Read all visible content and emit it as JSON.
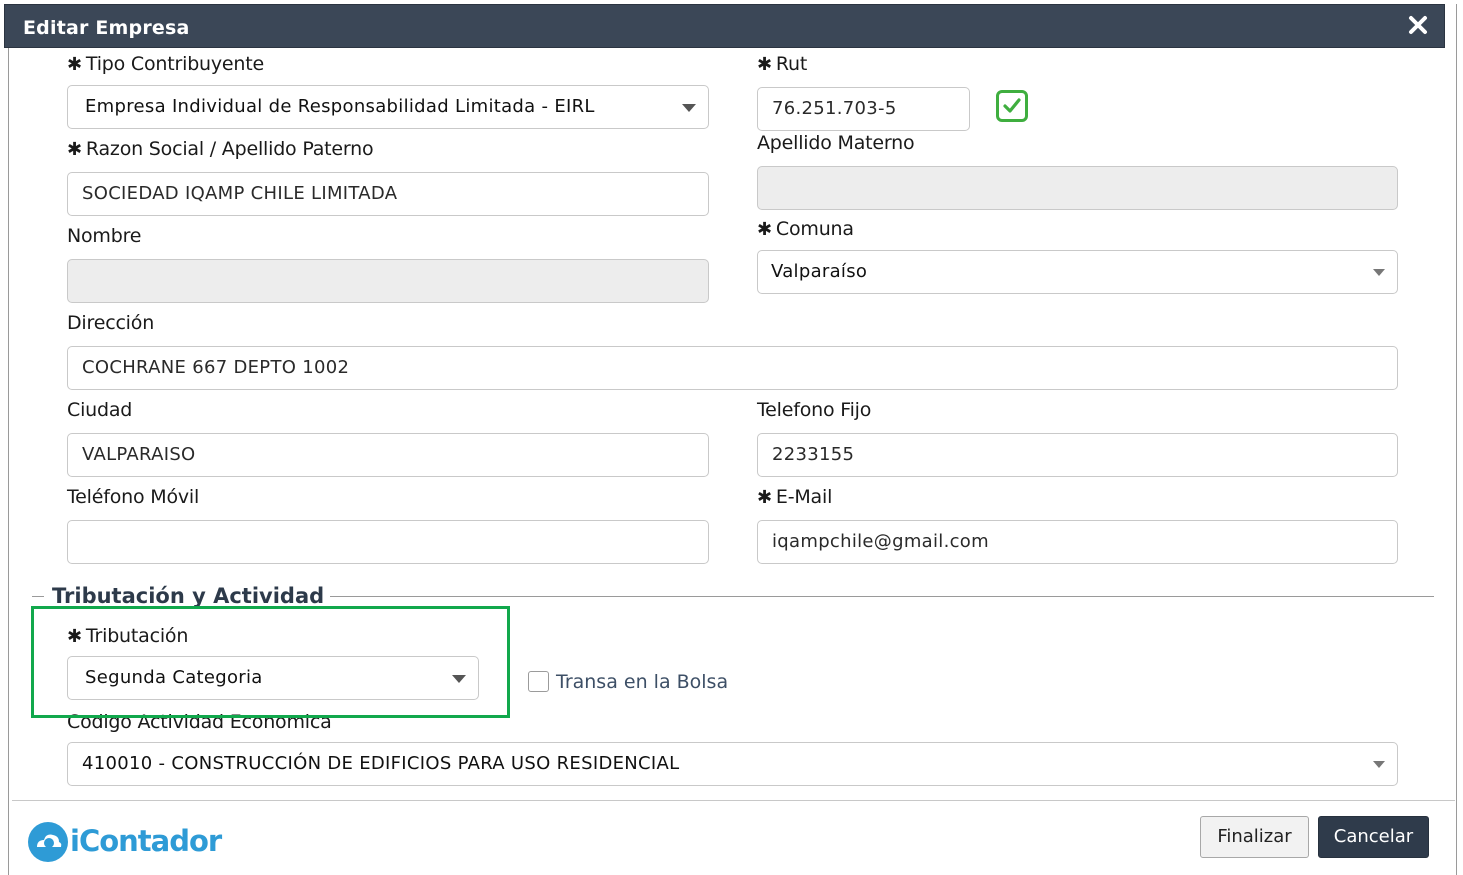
{
  "dialog": {
    "title": "Editar Empresa",
    "close_icon": "close-icon"
  },
  "required_marker": "✱",
  "form": {
    "tipo_contribuyente": {
      "label": "Tipo Contribuyente",
      "value": "Empresa Individual de Responsabilidad Limitada - EIRL"
    },
    "rut": {
      "label": "Rut",
      "value": "76.251.703-5",
      "valid_icon": "check-square-icon",
      "valid_color": "#3fae3f"
    },
    "razon_social": {
      "label": "Razon Social / Apellido Paterno",
      "value": "SOCIEDAD IQAMP CHILE LIMITADA"
    },
    "apellido_materno": {
      "label": "Apellido Materno",
      "value": ""
    },
    "nombre": {
      "label": "Nombre",
      "value": ""
    },
    "comuna": {
      "label": "Comuna",
      "value": "Valparaíso"
    },
    "direccion": {
      "label": "Dirección",
      "value": "COCHRANE 667 DEPTO 1002"
    },
    "ciudad": {
      "label": "Ciudad",
      "value": "VALPARAISO"
    },
    "telefono_fijo": {
      "label": "Telefono Fijo",
      "value": "2233155"
    },
    "telefono_movil": {
      "label": "Teléfono Móvil",
      "value": ""
    },
    "email": {
      "label": "E-Mail",
      "value": "iqampchile@gmail.com"
    }
  },
  "tributacion_section": {
    "title": "Tributación y Actividad",
    "tributacion": {
      "label": "Tributación",
      "value": "Segunda Categoria"
    },
    "transa_bolsa": {
      "label": "Transa en la Bolsa",
      "checked": false
    },
    "codigo_actividad": {
      "label": "Codigo Actividad Economica",
      "value": "410010 - CONSTRUCCIÓN DE EDIFICIOS PARA USO RESIDENCIAL"
    },
    "highlight_color": "#11a84c"
  },
  "footer": {
    "logo_text": "iContador",
    "logo_color": "#2e9bd6",
    "finalizar_label": "Finalizar",
    "cancelar_label": "Cancelar"
  },
  "colors": {
    "titlebar": "#3b4757",
    "primary_button": "#2f3b4b"
  }
}
